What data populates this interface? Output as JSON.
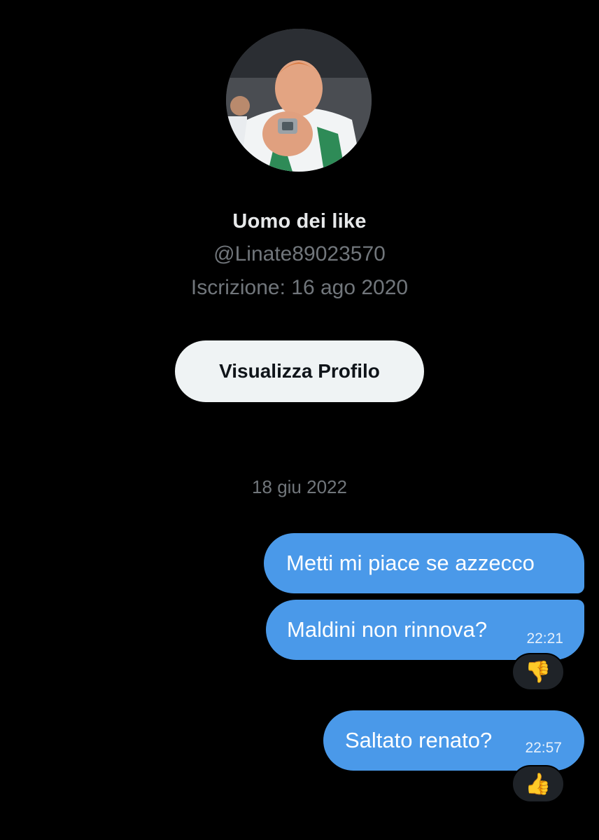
{
  "profile": {
    "display_name": "Uomo dei like",
    "handle": "@Linate89023570",
    "joined": "Iscrizione: 16 ago 2020",
    "view_profile_label": "Visualizza Profilo"
  },
  "conversation": {
    "date_separator": "18 giu 2022",
    "messages": [
      {
        "text": "Metti mi piace se azzecco",
        "time": "",
        "reaction": ""
      },
      {
        "text": "Maldini non rinnova?",
        "time": "22:21",
        "reaction": "👎"
      },
      {
        "text": "Saltato renato?",
        "time": "22:57",
        "reaction": "👍"
      }
    ]
  },
  "colors": {
    "background": "#000000",
    "bubble": "#4a99e9",
    "secondary_text": "#71767b",
    "primary_text": "#e7e9ea",
    "button_bg": "#eff3f4"
  },
  "icons": {
    "avatar": "profile-photo-basketball-player"
  }
}
